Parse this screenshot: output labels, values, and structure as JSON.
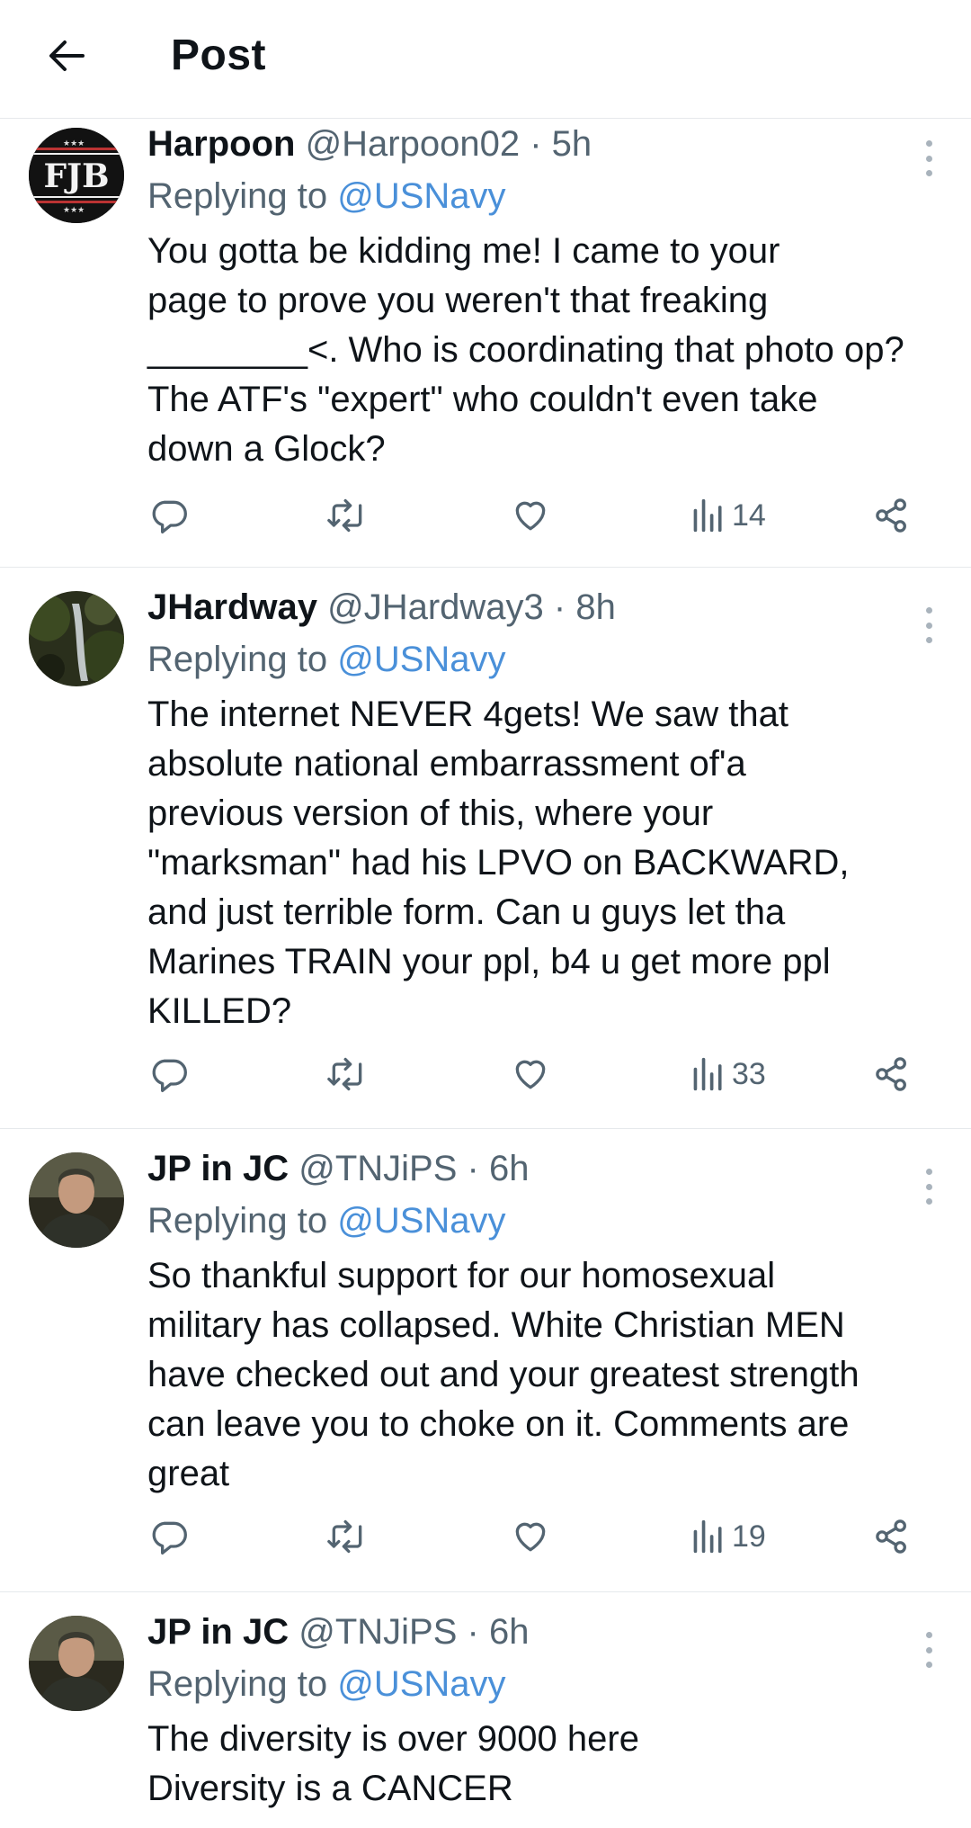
{
  "header": {
    "title": "Post",
    "back_icon": "arrow-left-icon"
  },
  "colors": {
    "text": "#0f1419",
    "secondary": "#536471",
    "mention": "#4a90d9",
    "divider": "#e6e9ec"
  },
  "posts": [
    {
      "name": "Harpoon",
      "handle": "@Harpoon02",
      "time": "· 5h",
      "replying_prefix": "Replying to",
      "replying_to": "@USNavy",
      "text": "You  gotta  be  kidding  me!  I came to your\npage to prove you weren't that freaking\n________<. Who is coordinating that photo op?\nThe ATF's \"expert\" who couldn't even take\ndown a Glock?",
      "views": "14",
      "avatar_text": "FJB"
    },
    {
      "name": "JHardway",
      "handle": "@JHardway3",
      "time": "· 8h",
      "replying_prefix": "Replying to",
      "replying_to": "@USNavy",
      "text": "The internet NEVER 4gets!  We saw that\nabsolute national embarrassment of'a\nprevious version of this, where your\n\"marksman\" had his LPVO on BACKWARD,\nand just terrible form.  Can u guys let tha\nMarines TRAIN your ppl, b4 u get more ppl\nKILLED?",
      "views": "33"
    },
    {
      "name": "JP in JC",
      "handle": "@TNJiPS",
      "time": "· 6h",
      "replying_prefix": "Replying to",
      "replying_to": "@USNavy",
      "text": "So thankful support for our homosexual\nmilitary has collapsed. White Christian MEN\nhave checked out and your greatest strength\ncan leave you to choke on it. Comments are\ngreat",
      "views": "19"
    },
    {
      "name": "JP in JC",
      "handle": "@TNJiPS",
      "time": "· 6h",
      "replying_prefix": "Replying to",
      "replying_to": "@USNavy",
      "text": "The diversity is over 9000 here\nDiversity is a CANCER"
    }
  ]
}
